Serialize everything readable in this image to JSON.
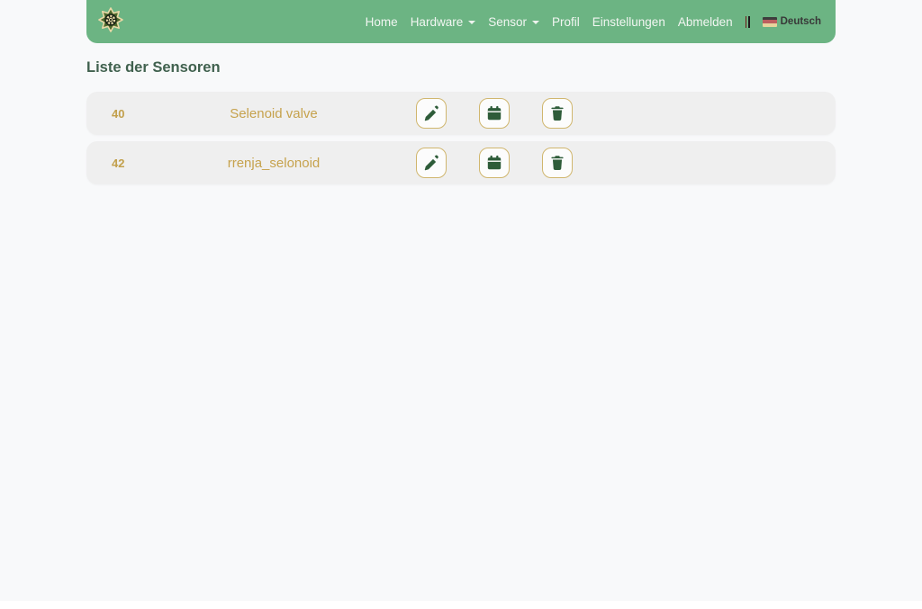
{
  "navbar": {
    "items": [
      {
        "label": "Home",
        "dropdown": false
      },
      {
        "label": "Hardware",
        "dropdown": true
      },
      {
        "label": "Sensor",
        "dropdown": true
      },
      {
        "label": "Profil",
        "dropdown": false
      },
      {
        "label": "Einstellungen",
        "dropdown": false
      },
      {
        "label": "Abmelden",
        "dropdown": false
      }
    ],
    "separator": "||",
    "language": {
      "label": "Deutsch",
      "flag_icon": "german-flag-icon"
    }
  },
  "page": {
    "title": "Liste der Sensoren"
  },
  "sensors": [
    {
      "id": "40",
      "name": "Selenoid valve"
    },
    {
      "id": "42",
      "name": "rrenja_selonoid"
    }
  ],
  "row_actions": [
    {
      "action": "edit",
      "icon": "pencil-icon"
    },
    {
      "action": "schedule",
      "icon": "calendar-icon"
    },
    {
      "action": "delete",
      "icon": "trash-icon"
    }
  ],
  "icons": {
    "logo": "gear-star-icon",
    "dropdown": "chevron-down-icon"
  },
  "colors": {
    "navbar_green": "#6cb483",
    "accent_gold_text": "#c6a24d",
    "accent_gold_border": "#d0b66e",
    "icon_dark_green": "#2e5c39",
    "heading_green": "#40614e",
    "row_background": "#efefef",
    "page_background": "#f8f9fa"
  }
}
